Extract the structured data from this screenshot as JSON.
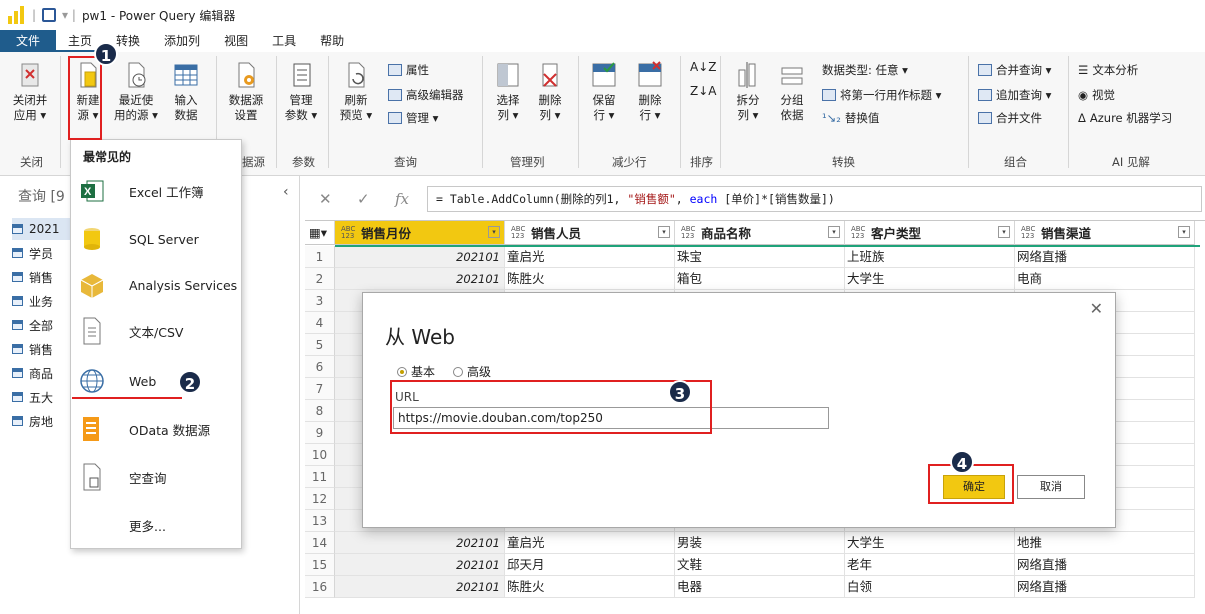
{
  "window": {
    "title": "pw1 - Power Query 编辑器"
  },
  "menu": {
    "file": "文件",
    "tabs": [
      "主页",
      "转换",
      "添加列",
      "视图",
      "工具",
      "帮助"
    ]
  },
  "ribbon": {
    "close_apply": [
      "关闭并",
      "应用 ▾"
    ],
    "new_source": [
      "新建",
      "源 ▾"
    ],
    "recent_sources": [
      "最近使",
      "用的源 ▾"
    ],
    "enter_data": [
      "输入",
      "数据"
    ],
    "datasource_settings": [
      "数据源",
      "设置"
    ],
    "manage_params": [
      "管理",
      "参数 ▾"
    ],
    "refresh_preview": [
      "刷新",
      "预览 ▾"
    ],
    "properties": "属性",
    "advanced_editor": "高级编辑器",
    "manage": "管理 ▾",
    "choose_columns": [
      "选择",
      "列 ▾"
    ],
    "remove_columns": [
      "删除",
      "列 ▾"
    ],
    "keep_rows": [
      "保留",
      "行 ▾"
    ],
    "remove_rows": [
      "删除",
      "行 ▾"
    ],
    "split_column": [
      "拆分",
      "列 ▾"
    ],
    "group_by": [
      "分组",
      "依据"
    ],
    "data_type": "数据类型: 任意 ▾",
    "first_row_header": "将第一行用作标题 ▾",
    "replace_values": "替换值",
    "merge_queries": "合并查询 ▾",
    "append_queries": "追加查询 ▾",
    "combine_files": "合并文件",
    "text_analytics": "文本分析",
    "vision": "视觉",
    "azure_ml": "Azure 机器学习",
    "groups": {
      "close": "关闭",
      "datasource": "据源",
      "params": "参数",
      "query": "查询",
      "manage_cols": "管理列",
      "reduce_rows": "减少行",
      "sort": "排序",
      "transform": "转换",
      "combine": "组合",
      "ai": "AI 见解"
    }
  },
  "queries": {
    "header": "查询 [9",
    "items": [
      "2021",
      "学员",
      "销售",
      "业务",
      "全部",
      "销售",
      "商品",
      "五大",
      "房地"
    ]
  },
  "new_source_menu": {
    "heading": "最常见的",
    "items": [
      "Excel 工作簿",
      "SQL Server",
      "Analysis Services",
      "文本/CSV",
      "Web",
      "OData 数据源",
      "空查询",
      "更多..."
    ]
  },
  "formula": {
    "prefix": "= Table.AddColumn(删除的列1, ",
    "str": "\"销售额\"",
    "mid": ", ",
    "kw": "each",
    "suffix": " [单价]*[销售数量])"
  },
  "grid": {
    "type_tag": "ABC\n123",
    "columns": [
      "销售月份",
      "销售人员",
      "商品名称",
      "客户类型",
      "销售渠道"
    ],
    "rows": [
      {
        "n": "1",
        "cells": [
          "202101",
          "童启光",
          "珠宝",
          "上班族",
          "网络直播"
        ]
      },
      {
        "n": "2",
        "cells": [
          "202101",
          "陈胜火",
          "箱包",
          "大学生",
          "电商"
        ]
      },
      {
        "n": "3",
        "cells": [
          "",
          "",
          "",
          "",
          ""
        ]
      },
      {
        "n": "4",
        "cells": [
          "",
          "",
          "",
          "",
          ""
        ]
      },
      {
        "n": "5",
        "cells": [
          "",
          "",
          "",
          "",
          ""
        ]
      },
      {
        "n": "6",
        "cells": [
          "",
          "",
          "",
          "",
          ""
        ]
      },
      {
        "n": "7",
        "cells": [
          "",
          "",
          "",
          "",
          ""
        ]
      },
      {
        "n": "8",
        "cells": [
          "",
          "",
          "",
          "",
          ""
        ]
      },
      {
        "n": "9",
        "cells": [
          "",
          "",
          "",
          "",
          ""
        ]
      },
      {
        "n": "10",
        "cells": [
          "",
          "",
          "",
          "",
          ""
        ]
      },
      {
        "n": "11",
        "cells": [
          "",
          "",
          "",
          "",
          ""
        ]
      },
      {
        "n": "12",
        "cells": [
          "",
          "",
          "",
          "",
          ""
        ]
      },
      {
        "n": "13",
        "cells": [
          "",
          "",
          "",
          "",
          ""
        ]
      },
      {
        "n": "14",
        "cells": [
          "202101",
          "童启光",
          "男装",
          "大学生",
          "地推"
        ]
      },
      {
        "n": "15",
        "cells": [
          "202101",
          "邱天月",
          "文鞋",
          "老年",
          "网络直播"
        ]
      },
      {
        "n": "16",
        "cells": [
          "202101",
          "陈胜火",
          "电器",
          "白领",
          "网络直播"
        ]
      }
    ]
  },
  "dialog": {
    "title": "从 Web",
    "radio_basic": "基本",
    "radio_advanced": "高级",
    "url_label": "URL",
    "url_value": "https://movie.douban.com/top250",
    "ok": "确定",
    "cancel": "取消",
    "close": "✕"
  },
  "annotations": {
    "b1": "1",
    "b2": "2",
    "b3": "3",
    "b4": "4"
  },
  "colors": {
    "accent": "#f2c811",
    "file_tab": "#1f5c8c",
    "annotation_red": "#e02020"
  }
}
